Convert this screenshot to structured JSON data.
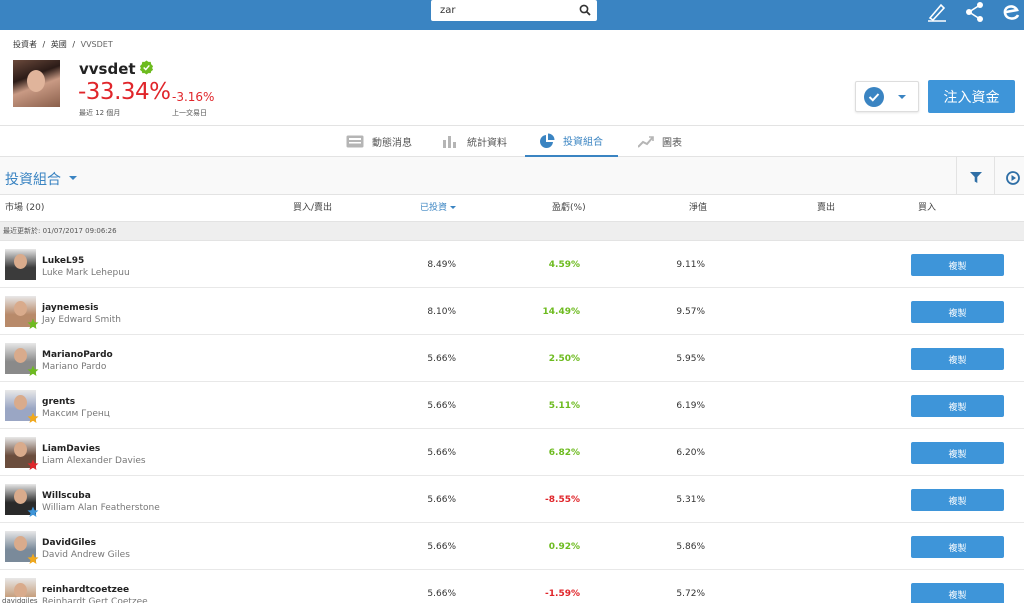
{
  "search": {
    "value": "zar"
  },
  "breadcrumb": [
    "投資者",
    "/",
    "英國",
    "/",
    "VVSDET"
  ],
  "profile": {
    "username": "vvsdet",
    "gain": "-33.34%",
    "gain_label": "最近 12 個月",
    "daily_gain": "-3.16%",
    "daily_label": "上一交易日",
    "deposit_label": "注入資金"
  },
  "tabs": [
    {
      "label": "動態消息",
      "icon": "newsfeed-icon"
    },
    {
      "label": "統計資料",
      "icon": "stats-bar-icon"
    },
    {
      "label": "投資組合",
      "icon": "pie-chart-icon",
      "active": true
    },
    {
      "label": "圖表",
      "icon": "line-chart-icon"
    }
  ],
  "section": {
    "title": "投資組合"
  },
  "columns": {
    "market": "市場 (20)",
    "buy_sell": "買入/賣出",
    "invested": "已投資",
    "pl": "盈虧(%)",
    "value": "淨值",
    "sell": "賣出",
    "buy": "買入"
  },
  "updated": "最近更新於: 01/07/2017 09:06:26",
  "copy_label": "複製",
  "rows": [
    {
      "username": "LukeL95",
      "fullname": "Luke Mark Lehepuu",
      "invested": "8.49%",
      "pl": "4.59%",
      "pl_sign": "pos",
      "value": "9.11%",
      "star": "",
      "avatar_color": "#3b3b3b"
    },
    {
      "username": "jaynemesis",
      "fullname": "Jay Edward Smith",
      "invested": "8.10%",
      "pl": "14.49%",
      "pl_sign": "pos",
      "value": "9.57%",
      "star": "#6dbb1f",
      "avatar_color": "#b88a6a"
    },
    {
      "username": "MarianoPardo",
      "fullname": "Mariano Pardo",
      "invested": "5.66%",
      "pl": "2.50%",
      "pl_sign": "pos",
      "value": "5.95%",
      "star": "#6dbb1f",
      "avatar_color": "#8a8a8a"
    },
    {
      "username": "grents",
      "fullname": "Максим Гренц",
      "invested": "5.66%",
      "pl": "5.11%",
      "pl_sign": "pos",
      "value": "6.19%",
      "star": "#f2a91b",
      "avatar_color": "#9aa6c4"
    },
    {
      "username": "LiamDavies",
      "fullname": "Liam Alexander Davies",
      "invested": "5.66%",
      "pl": "6.82%",
      "pl_sign": "pos",
      "value": "6.20%",
      "star": "#e0262b",
      "avatar_color": "#6b4d3d"
    },
    {
      "username": "Willscuba",
      "fullname": "William Alan Featherstone",
      "invested": "5.66%",
      "pl": "-8.55%",
      "pl_sign": "neg",
      "value": "5.31%",
      "star": "#3e95d9",
      "avatar_color": "#2a2a2a"
    },
    {
      "username": "DavidGiles",
      "fullname": "David Andrew Giles",
      "invested": "5.66%",
      "pl": "0.92%",
      "pl_sign": "pos",
      "value": "5.86%",
      "star": "#f2a91b",
      "avatar_color": "#7a8a9a"
    },
    {
      "username": "reinhardtcoetzee",
      "fullname": "Reinhardt Gert Coetzee",
      "invested": "5.66%",
      "pl": "-1.59%",
      "pl_sign": "neg",
      "value": "5.72%",
      "star": "",
      "avatar_color": "#c7a07f"
    }
  ],
  "tooltip": "davidgiles"
}
